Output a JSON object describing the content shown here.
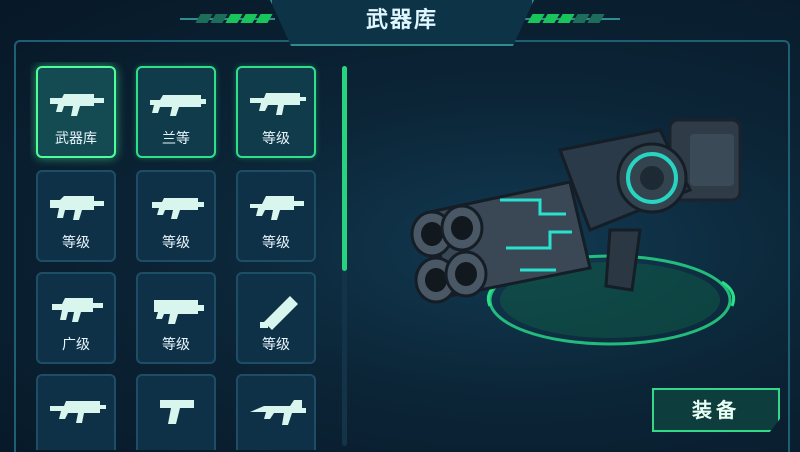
{
  "header": {
    "title": "武器库"
  },
  "colors": {
    "accent": "#2fe08a",
    "panel": "#0f3147",
    "background": "#0b2436"
  },
  "weapon_slots": [
    {
      "label": "武器库",
      "icon": "assault-rifle-icon",
      "state": "selected"
    },
    {
      "label": "兰等",
      "icon": "shotgun-icon",
      "state": "owned"
    },
    {
      "label": "等级",
      "icon": "rifle-icon",
      "state": "owned"
    },
    {
      "label": "等级",
      "icon": "smg-icon",
      "state": "locked"
    },
    {
      "label": "等级",
      "icon": "pistol-rifle-icon",
      "state": "locked"
    },
    {
      "label": "等级",
      "icon": "carbine-icon",
      "state": "locked"
    },
    {
      "label": "广级",
      "icon": "smg-icon",
      "state": "locked"
    },
    {
      "label": "等级",
      "icon": "blaster-icon",
      "state": "locked"
    },
    {
      "label": "等级",
      "icon": "launcher-icon",
      "state": "locked"
    },
    {
      "label": "",
      "icon": "rifle-icon",
      "state": "locked"
    },
    {
      "label": "",
      "icon": "pistol-icon",
      "state": "locked"
    },
    {
      "label": "",
      "icon": "heavy-gun-icon",
      "state": "locked"
    }
  ],
  "preview": {
    "weapon_icon": "quad-barrel-cannon"
  },
  "actions": {
    "equip_label": "装备"
  }
}
